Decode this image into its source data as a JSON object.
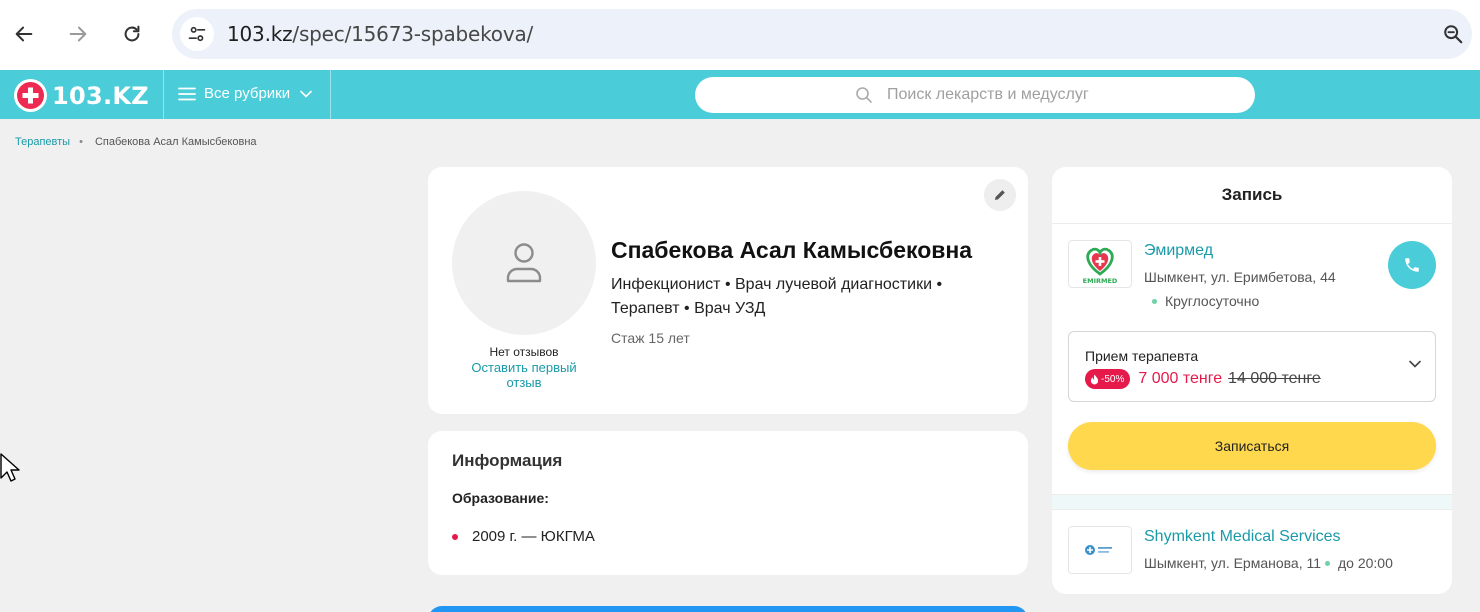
{
  "browser": {
    "url_domain": "103.kz",
    "url_path": "/spec/15673-spabekova/"
  },
  "site": {
    "logo_text": "103.KZ",
    "rubrics_label": "Все рубрики",
    "search_placeholder": "Поиск лекарств и медуслуг"
  },
  "breadcrumb": {
    "parent": "Терапевты",
    "separator": "•",
    "current": "Спабекова Асал Камысбековна"
  },
  "profile": {
    "name": "Спабекова Асал Камысбековна",
    "specialties_line1": "Инфекционист • Врач лучевой диагностики •",
    "specialties_line2": "Терапевт • Врач УЗД",
    "experience": "Стаж 15 лет",
    "reviews_status": "Нет отзывов",
    "leave_review": "Оставить первый отзыв"
  },
  "info": {
    "title": "Информация",
    "education_label": "Образование:",
    "education_items": [
      "2009 г. — ЮКГМА"
    ]
  },
  "booking": {
    "title": "Запись",
    "clinics": [
      {
        "name": "Эмирмед",
        "logo_text": "EMIRMED",
        "address": "Шымкент, ул. Еримбетова, 44",
        "hours": "Круглосуточно"
      },
      {
        "name": "Shymkent Medical Services",
        "address": "Шымкент, ул. Ерманова, 11",
        "hours": "до 20:00"
      }
    ],
    "service": {
      "name": "Прием терапевта",
      "discount": "-50%",
      "price_new": "7 000 тенге",
      "price_old": "14 000 тенге"
    },
    "book_button": "Записаться"
  },
  "colors": {
    "brand_teal": "#4acdd8",
    "link_teal": "#1a9aa8",
    "accent_red": "#e6194b",
    "button_yellow": "#ffd84d"
  },
  "icons": {
    "back": "arrow-left-icon",
    "forward": "arrow-right-icon",
    "reload": "reload-icon",
    "site_settings": "tune-icon",
    "zoom": "zoom-icon",
    "logo": "medical-cross-icon",
    "menu": "hamburger-icon",
    "search": "search-icon",
    "avatar": "user-icon",
    "edit": "pencil-icon",
    "phone": "phone-icon"
  }
}
